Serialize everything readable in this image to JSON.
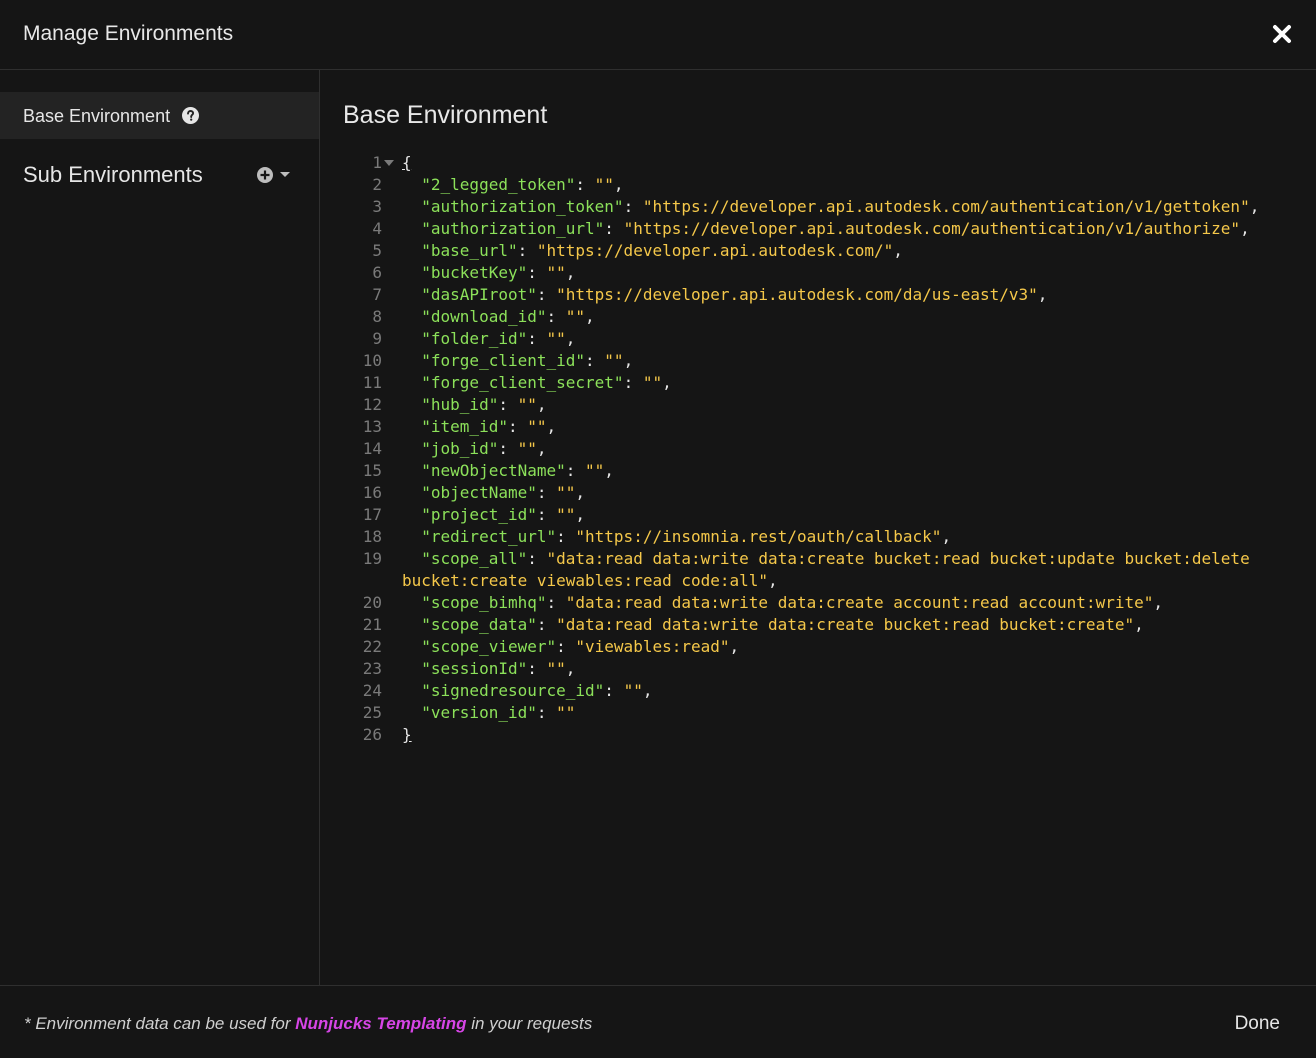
{
  "dialog": {
    "title": "Manage Environments",
    "close_icon": "close-icon"
  },
  "sidebar": {
    "base_environment_label": "Base Environment",
    "help_icon": "help-icon",
    "sub_environments_label": "Sub Environments",
    "add_icon": "plus-circle-icon",
    "dropdown_icon": "caret-down-icon"
  },
  "main": {
    "title": "Base Environment",
    "editor": {
      "open_brace": "{",
      "close_brace": "}",
      "entries": [
        {
          "key": "\"2_legged_token\"",
          "value": "\"\""
        },
        {
          "key": "\"authorization_token\"",
          "value": "\"https://developer.api.autodesk.com/authentication/v1/gettoken\""
        },
        {
          "key": "\"authorization_url\"",
          "value": "\"https://developer.api.autodesk.com/authentication/v1/authorize\""
        },
        {
          "key": "\"base_url\"",
          "value": "\"https://developer.api.autodesk.com/\""
        },
        {
          "key": "\"bucketKey\"",
          "value": "\"\""
        },
        {
          "key": "\"dasAPIroot\"",
          "value": "\"https://developer.api.autodesk.com/da/us-east/v3\""
        },
        {
          "key": "\"download_id\"",
          "value": "\"\""
        },
        {
          "key": "\"folder_id\"",
          "value": "\"\""
        },
        {
          "key": "\"forge_client_id\"",
          "value": "\"\""
        },
        {
          "key": "\"forge_client_secret\"",
          "value": "\"\""
        },
        {
          "key": "\"hub_id\"",
          "value": "\"\""
        },
        {
          "key": "\"item_id\"",
          "value": "\"\""
        },
        {
          "key": "\"job_id\"",
          "value": "\"\""
        },
        {
          "key": "\"newObjectName\"",
          "value": "\"\""
        },
        {
          "key": "\"objectName\"",
          "value": "\"\""
        },
        {
          "key": "\"project_id\"",
          "value": "\"\""
        },
        {
          "key": "\"redirect_url\"",
          "value": "\"https://insomnia.rest/oauth/callback\""
        },
        {
          "key": "\"scope_all\"",
          "value": "\"data:read data:write data:create bucket:read bucket:update bucket:delete",
          "value_wrap": "bucket:create viewables:read code:all\""
        },
        {
          "key": "\"scope_bimhq\"",
          "value": "\"data:read data:write data:create account:read account:write\""
        },
        {
          "key": "\"scope_data\"",
          "value": "\"data:read data:write data:create bucket:read bucket:create\""
        },
        {
          "key": "\"scope_viewer\"",
          "value": "\"viewables:read\""
        },
        {
          "key": "\"sessionId\"",
          "value": "\"\""
        },
        {
          "key": "\"signedresource_id\"",
          "value": "\"\""
        },
        {
          "key": "\"version_id\"",
          "value": "\"\""
        }
      ]
    }
  },
  "footer": {
    "note_prefix": "* Environment data can be used for ",
    "note_link": "Nunjucks Templating",
    "note_suffix": " in your requests",
    "done_label": "Done"
  }
}
